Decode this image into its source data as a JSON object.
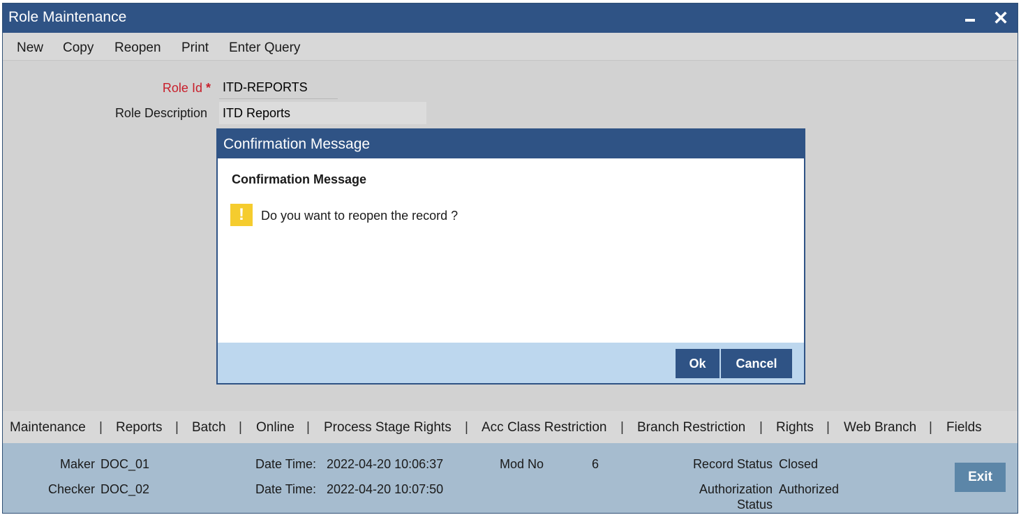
{
  "window": {
    "title": "Role Maintenance"
  },
  "toolbar": {
    "new": "New",
    "copy": "Copy",
    "reopen": "Reopen",
    "print": "Print",
    "enter_query": "Enter Query"
  },
  "form": {
    "role_id_label": "Role Id",
    "required_mark": "*",
    "role_id_value": "ITD-REPORTS",
    "role_description_label": "Role Description",
    "role_description_value": "ITD Reports"
  },
  "dialog": {
    "title": "Confirmation Message",
    "heading": "Confirmation Message",
    "icon": "!",
    "message": "Do you want to reopen the record ?",
    "ok_label": "Ok",
    "cancel_label": "Cancel"
  },
  "tabs": {
    "separator": "|",
    "items": [
      "Maintenance",
      "Reports",
      "Batch",
      "Online",
      "Process Stage Rights",
      "Acc Class Restriction",
      "Branch Restriction",
      "Rights",
      "Web Branch",
      "Fields"
    ]
  },
  "audit": {
    "maker_label": "Maker",
    "maker_value": "DOC_01",
    "checker_label": "Checker",
    "checker_value": "DOC_02",
    "date_time_label": "Date Time:",
    "maker_date_time": "2022-04-20 10:06:37",
    "checker_date_time": "2022-04-20 10:07:50",
    "mod_no_label": "Mod No",
    "mod_no_value": "6",
    "record_status_label": "Record Status",
    "record_status_value": "Closed",
    "auth_status_label_1": "Authorization",
    "auth_status_label_2": "Status",
    "auth_status_value": "Authorized",
    "exit_label": "Exit"
  },
  "colors": {
    "header_blue": "#2f5385",
    "required_red": "#c81e2a",
    "warning_yellow": "#f5cc2e",
    "footer_blue": "#a6bccf"
  }
}
